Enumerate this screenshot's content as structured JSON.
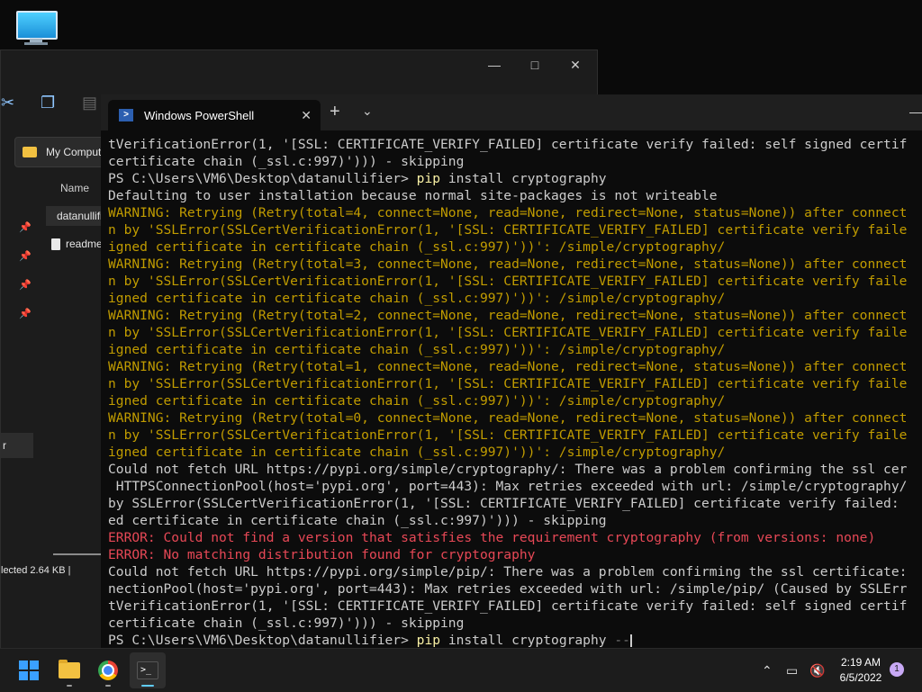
{
  "desktop": {
    "icon": "monitor-icon"
  },
  "explorer": {
    "address_label": "My Computer",
    "column_name": "Name",
    "files": [
      "datanullifier",
      "readme"
    ],
    "nav_selected_label": "r",
    "status": "lected  2.64 KB  |"
  },
  "terminal": {
    "tab_title": "Windows PowerShell",
    "prompt": "PS C:\\Users\\VM6\\Desktop\\datanullifier> ",
    "lines": [
      {
        "t": "tVerificationError(1, '[SSL: CERTIFICATE_VERIFY_FAILED] certificate verify failed: self signed certif",
        "k": ""
      },
      {
        "t": "certificate chain (_ssl.c:997)'))) - skipping",
        "k": ""
      },
      {
        "t": "PS C:\\Users\\VM6\\Desktop\\datanullifier> pip install cryptography",
        "k": "cmd"
      },
      {
        "t": "Defaulting to user installation because normal site-packages is not writeable",
        "k": ""
      },
      {
        "t": "WARNING: Retrying (Retry(total=4, connect=None, read=None, redirect=None, status=None)) after connect",
        "k": "warn"
      },
      {
        "t": "n by 'SSLError(SSLCertVerificationError(1, '[SSL: CERTIFICATE_VERIFY_FAILED] certificate verify faile",
        "k": "warn"
      },
      {
        "t": "igned certificate in certificate chain (_ssl.c:997)'))': /simple/cryptography/",
        "k": "warn"
      },
      {
        "t": "WARNING: Retrying (Retry(total=3, connect=None, read=None, redirect=None, status=None)) after connect",
        "k": "warn"
      },
      {
        "t": "n by 'SSLError(SSLCertVerificationError(1, '[SSL: CERTIFICATE_VERIFY_FAILED] certificate verify faile",
        "k": "warn"
      },
      {
        "t": "igned certificate in certificate chain (_ssl.c:997)'))': /simple/cryptography/",
        "k": "warn"
      },
      {
        "t": "WARNING: Retrying (Retry(total=2, connect=None, read=None, redirect=None, status=None)) after connect",
        "k": "warn"
      },
      {
        "t": "n by 'SSLError(SSLCertVerificationError(1, '[SSL: CERTIFICATE_VERIFY_FAILED] certificate verify faile",
        "k": "warn"
      },
      {
        "t": "igned certificate in certificate chain (_ssl.c:997)'))': /simple/cryptography/",
        "k": "warn"
      },
      {
        "t": "WARNING: Retrying (Retry(total=1, connect=None, read=None, redirect=None, status=None)) after connect",
        "k": "warn"
      },
      {
        "t": "n by 'SSLError(SSLCertVerificationError(1, '[SSL: CERTIFICATE_VERIFY_FAILED] certificate verify faile",
        "k": "warn"
      },
      {
        "t": "igned certificate in certificate chain (_ssl.c:997)'))': /simple/cryptography/",
        "k": "warn"
      },
      {
        "t": "WARNING: Retrying (Retry(total=0, connect=None, read=None, redirect=None, status=None)) after connect",
        "k": "warn"
      },
      {
        "t": "n by 'SSLError(SSLCertVerificationError(1, '[SSL: CERTIFICATE_VERIFY_FAILED] certificate verify faile",
        "k": "warn"
      },
      {
        "t": "igned certificate in certificate chain (_ssl.c:997)'))': /simple/cryptography/",
        "k": "warn"
      },
      {
        "t": "Could not fetch URL https://pypi.org/simple/cryptography/: There was a problem confirming the ssl cer",
        "k": ""
      },
      {
        "t": " HTTPSConnectionPool(host='pypi.org', port=443): Max retries exceeded with url: /simple/cryptography/",
        "k": ""
      },
      {
        "t": "by SSLError(SSLCertVerificationError(1, '[SSL: CERTIFICATE_VERIFY_FAILED] certificate verify failed:",
        "k": ""
      },
      {
        "t": "ed certificate in certificate chain (_ssl.c:997)'))) - skipping",
        "k": ""
      },
      {
        "t": "ERROR: Could not find a version that satisfies the requirement cryptography (from versions: none)",
        "k": "err"
      },
      {
        "t": "ERROR: No matching distribution found for cryptography",
        "k": "err"
      },
      {
        "t": "Could not fetch URL https://pypi.org/simple/pip/: There was a problem confirming the ssl certificate:",
        "k": ""
      },
      {
        "t": "nectionPool(host='pypi.org', port=443): Max retries exceeded with url: /simple/pip/ (Caused by SSLErr",
        "k": ""
      },
      {
        "t": "tVerificationError(1, '[SSL: CERTIFICATE_VERIFY_FAILED] certificate verify failed: self signed certif",
        "k": ""
      },
      {
        "t": "certificate chain (_ssl.c:997)'))) - skipping",
        "k": ""
      }
    ],
    "current_command": {
      "cmd": "pip",
      "args": " install cryptography ",
      "partial": "--"
    }
  },
  "taskbar": {
    "time": "2:19 AM",
    "date": "6/5/2022",
    "notification_count": "1"
  },
  "colors": {
    "accent": "#60cdff",
    "warn": "#c19c00",
    "error": "#e74856"
  }
}
